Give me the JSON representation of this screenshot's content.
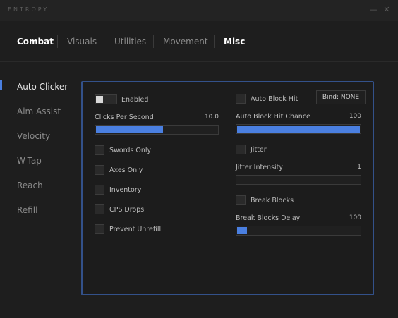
{
  "window": {
    "title": "ENTROPY",
    "minimize_glyph": "—",
    "close_glyph": "✕"
  },
  "tabs": [
    {
      "label": "Combat",
      "active": true
    },
    {
      "label": "Visuals",
      "active": false
    },
    {
      "label": "Utilities",
      "active": false
    },
    {
      "label": "Movement",
      "active": false
    },
    {
      "label": "Misc",
      "active": true
    }
  ],
  "sidebar": {
    "items": [
      {
        "label": "Auto Clicker",
        "active": true
      },
      {
        "label": "Aim Assist",
        "active": false
      },
      {
        "label": "Velocity",
        "active": false
      },
      {
        "label": "W-Tap",
        "active": false
      },
      {
        "label": "Reach",
        "active": false
      },
      {
        "label": "Refill",
        "active": false
      }
    ]
  },
  "module": {
    "enabled": {
      "label": "Enabled",
      "value": true
    },
    "cps": {
      "label": "Clicks Per Second",
      "value": "10.0",
      "fill": 0.55
    },
    "left_options": [
      {
        "label": "Swords Only",
        "checked": false
      },
      {
        "label": "Axes Only",
        "checked": false
      },
      {
        "label": "Inventory",
        "checked": false
      },
      {
        "label": "CPS Drops",
        "checked": false
      },
      {
        "label": "Prevent Unrefill",
        "checked": false
      }
    ],
    "auto_block_hit": {
      "label": "Auto Block Hit",
      "checked": false
    },
    "bind": {
      "label": "Bind: NONE"
    },
    "auto_block_chance": {
      "label": "Auto Block Hit Chance",
      "value": "100",
      "fill": 1.0
    },
    "jitter": {
      "label": "Jitter",
      "checked": false
    },
    "jitter_intensity": {
      "label": "Jitter Intensity",
      "value": "1",
      "fill": 0.0
    },
    "break_blocks": {
      "label": "Break Blocks",
      "checked": false
    },
    "break_blocks_delay": {
      "label": "Break Blocks Delay",
      "value": "100",
      "fill": 0.08
    }
  },
  "colors": {
    "accent": "#4a7fe0",
    "panel_border": "#33518a",
    "background": "#1e1e1e"
  }
}
